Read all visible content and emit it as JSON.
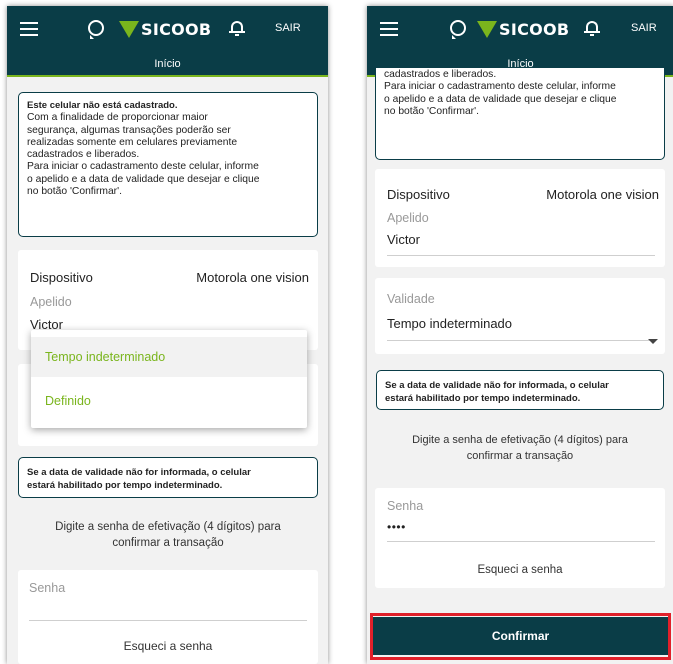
{
  "header": {
    "logo_text": "SICOOB",
    "logout_label": "SAIR",
    "page_label": "Início"
  },
  "info": {
    "title": "Este celular não está cadastrado.",
    "line1": "Com a finalidade de proporcionar maior",
    "line2": "segurança, algumas transações poderão ser",
    "line3": "realizadas somente em celulares previamente",
    "line4": "cadastrados e liberados.",
    "line5": "Para iniciar o cadastramento deste celular, informe",
    "line6": "o apelido e a data de validade que desejar e clique",
    "line7": "no botão 'Confirmar'."
  },
  "device": {
    "label": "Dispositivo",
    "value": "Motorola one vision",
    "nickname_label": "Apelido",
    "nickname_value": "Victor"
  },
  "validity": {
    "label": "Validade",
    "value": "Tempo indeterminado",
    "options": [
      "Tempo indeterminado",
      "Definido"
    ]
  },
  "note": {
    "line1": "Se a data de validade não for informada, o celular",
    "line2": "estará habilitado por tempo indeterminado."
  },
  "password": {
    "instruction1": "Digite a senha de efetivação (4 dígitos) para",
    "instruction2": "confirmar a transação",
    "label": "Senha",
    "value": "••••",
    "forgot": "Esqueci a senha"
  },
  "confirm_label": "Confirmar",
  "colors": {
    "brand_dark": "#0a3d47",
    "brand_green": "#7ab51d",
    "highlight_red": "#e0202a"
  }
}
